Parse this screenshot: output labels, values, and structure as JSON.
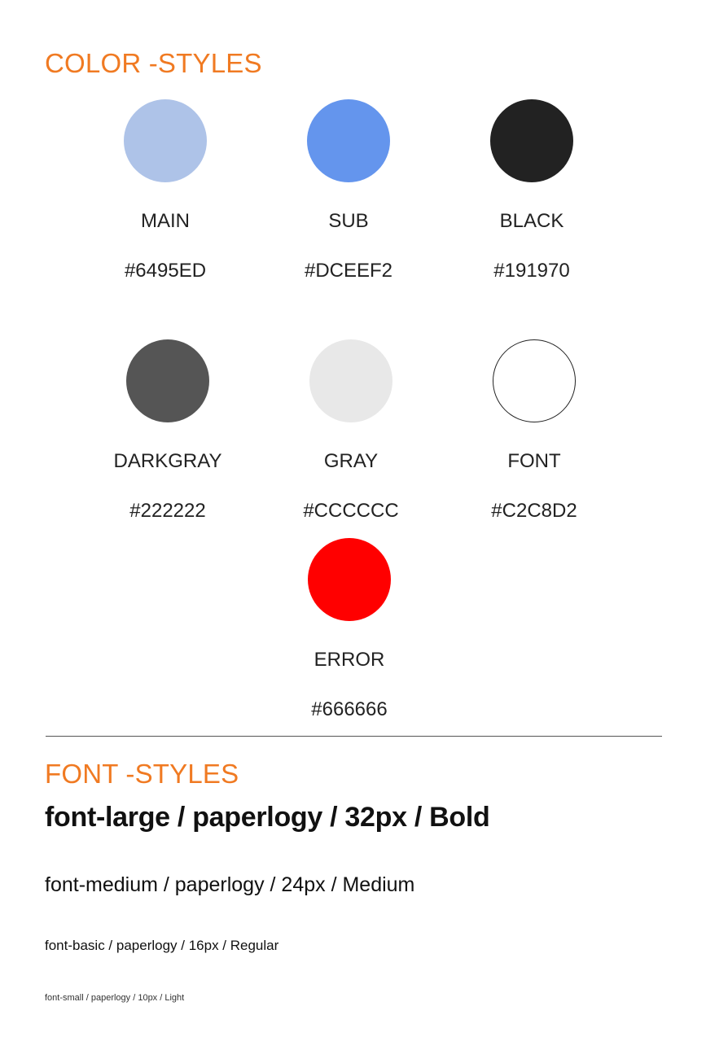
{
  "color_section": {
    "title": "COLOR -STYLES",
    "title_color": "#f07a22",
    "swatches": [
      {
        "name": "MAIN",
        "hex": "#6495ED",
        "fill": "#aec3e8"
      },
      {
        "name": "SUB",
        "hex": "#DCEEF2",
        "fill": "#6495ED"
      },
      {
        "name": "BLACK",
        "hex": "#191970",
        "fill": "#222222"
      },
      {
        "name": "DARKGRAY",
        "hex": "#222222",
        "fill": "#555555"
      },
      {
        "name": "GRAY",
        "hex": "#CCCCCC",
        "fill": "#e8e8e8"
      },
      {
        "name": "FONT",
        "hex": "#C2C8D2",
        "fill": "#ffffff"
      },
      {
        "name": "ERROR",
        "hex": "#666666",
        "fill": "#ff0000"
      }
    ]
  },
  "font_section": {
    "title": "FONT -STYLES",
    "samples": [
      "font-large / paperlogy / 32px / Bold",
      "font-medium / paperlogy / 24px / Medium",
      "font-basic / paperlogy / 16px / Regular",
      "font-small / paperlogy / 10px / Light"
    ]
  }
}
